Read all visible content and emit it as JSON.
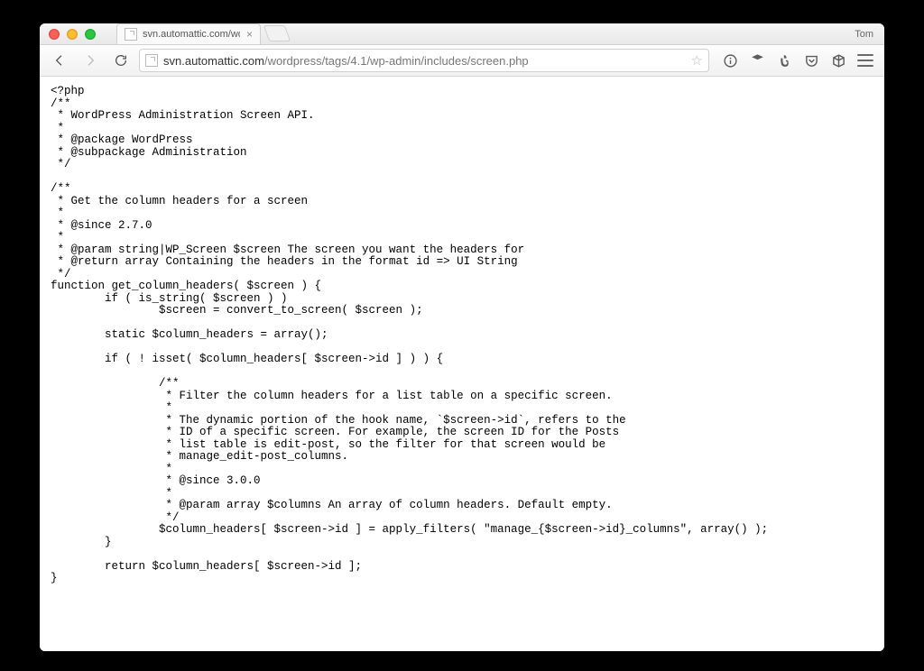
{
  "profile_name": "Tom",
  "tab": {
    "title": "svn.automattic.com/wordp"
  },
  "url": {
    "host": "svn.automattic.com",
    "path": "/wordpress/tags/4.1/wp-admin/includes/screen.php"
  },
  "code": "<?php\n/**\n * WordPress Administration Screen API.\n *\n * @package WordPress\n * @subpackage Administration\n */\n\n/**\n * Get the column headers for a screen\n *\n * @since 2.7.0\n *\n * @param string|WP_Screen $screen The screen you want the headers for\n * @return array Containing the headers in the format id => UI String\n */\nfunction get_column_headers( $screen ) {\n        if ( is_string( $screen ) )\n                $screen = convert_to_screen( $screen );\n\n        static $column_headers = array();\n\n        if ( ! isset( $column_headers[ $screen->id ] ) ) {\n\n                /**\n                 * Filter the column headers for a list table on a specific screen.\n                 *\n                 * The dynamic portion of the hook name, `$screen->id`, refers to the\n                 * ID of a specific screen. For example, the screen ID for the Posts\n                 * list table is edit-post, so the filter for that screen would be\n                 * manage_edit-post_columns.\n                 *\n                 * @since 3.0.0\n                 *\n                 * @param array $columns An array of column headers. Default empty.\n                 */\n                $column_headers[ $screen->id ] = apply_filters( \"manage_{$screen->id}_columns\", array() );\n        }\n\n        return $column_headers[ $screen->id ];\n}"
}
